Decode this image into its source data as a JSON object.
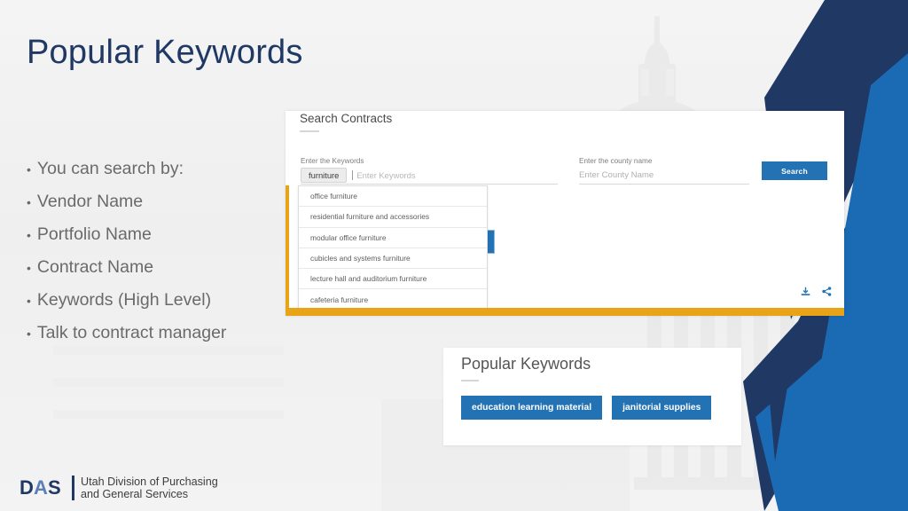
{
  "slide": {
    "title": "Popular Keywords",
    "bullets": [
      "You can search by:",
      "Vendor Name",
      "Portfolio Name",
      "Contract Name",
      "Keywords (High Level)",
      "Talk to contract manager"
    ],
    "bullet_marker": "•"
  },
  "screenshot": {
    "heading": "Search Contracts",
    "keywords_field": {
      "label": "Enter the Keywords",
      "chip": "furniture",
      "placeholder": "Enter Keywords"
    },
    "county_field": {
      "label": "Enter the county name",
      "placeholder": "Enter County Name"
    },
    "search_button": "Search",
    "suggestions": [
      "office furniture",
      "residential furniture and accessories",
      "modular office furniture",
      "cubicles and systems furniture",
      "lecture hall and auditorium furniture",
      "cafeteria furniture"
    ],
    "icons": {
      "download": "download-icon",
      "share": "share-icon"
    }
  },
  "keywords_card": {
    "title": "Popular Keywords",
    "buttons": [
      "education learning material",
      "janitorial supplies"
    ]
  },
  "footer": {
    "logo_mark": "DAS",
    "logo_line1": "Utah Division of Purchasing",
    "logo_line2": "and General Services"
  },
  "colors": {
    "title_navy": "#203864",
    "accent_blue": "#2272b4",
    "deco_navy": "#1f3864",
    "deco_blue": "#1b6ab4",
    "orange": "#e8a317",
    "body_gray": "#6a6a6a"
  }
}
